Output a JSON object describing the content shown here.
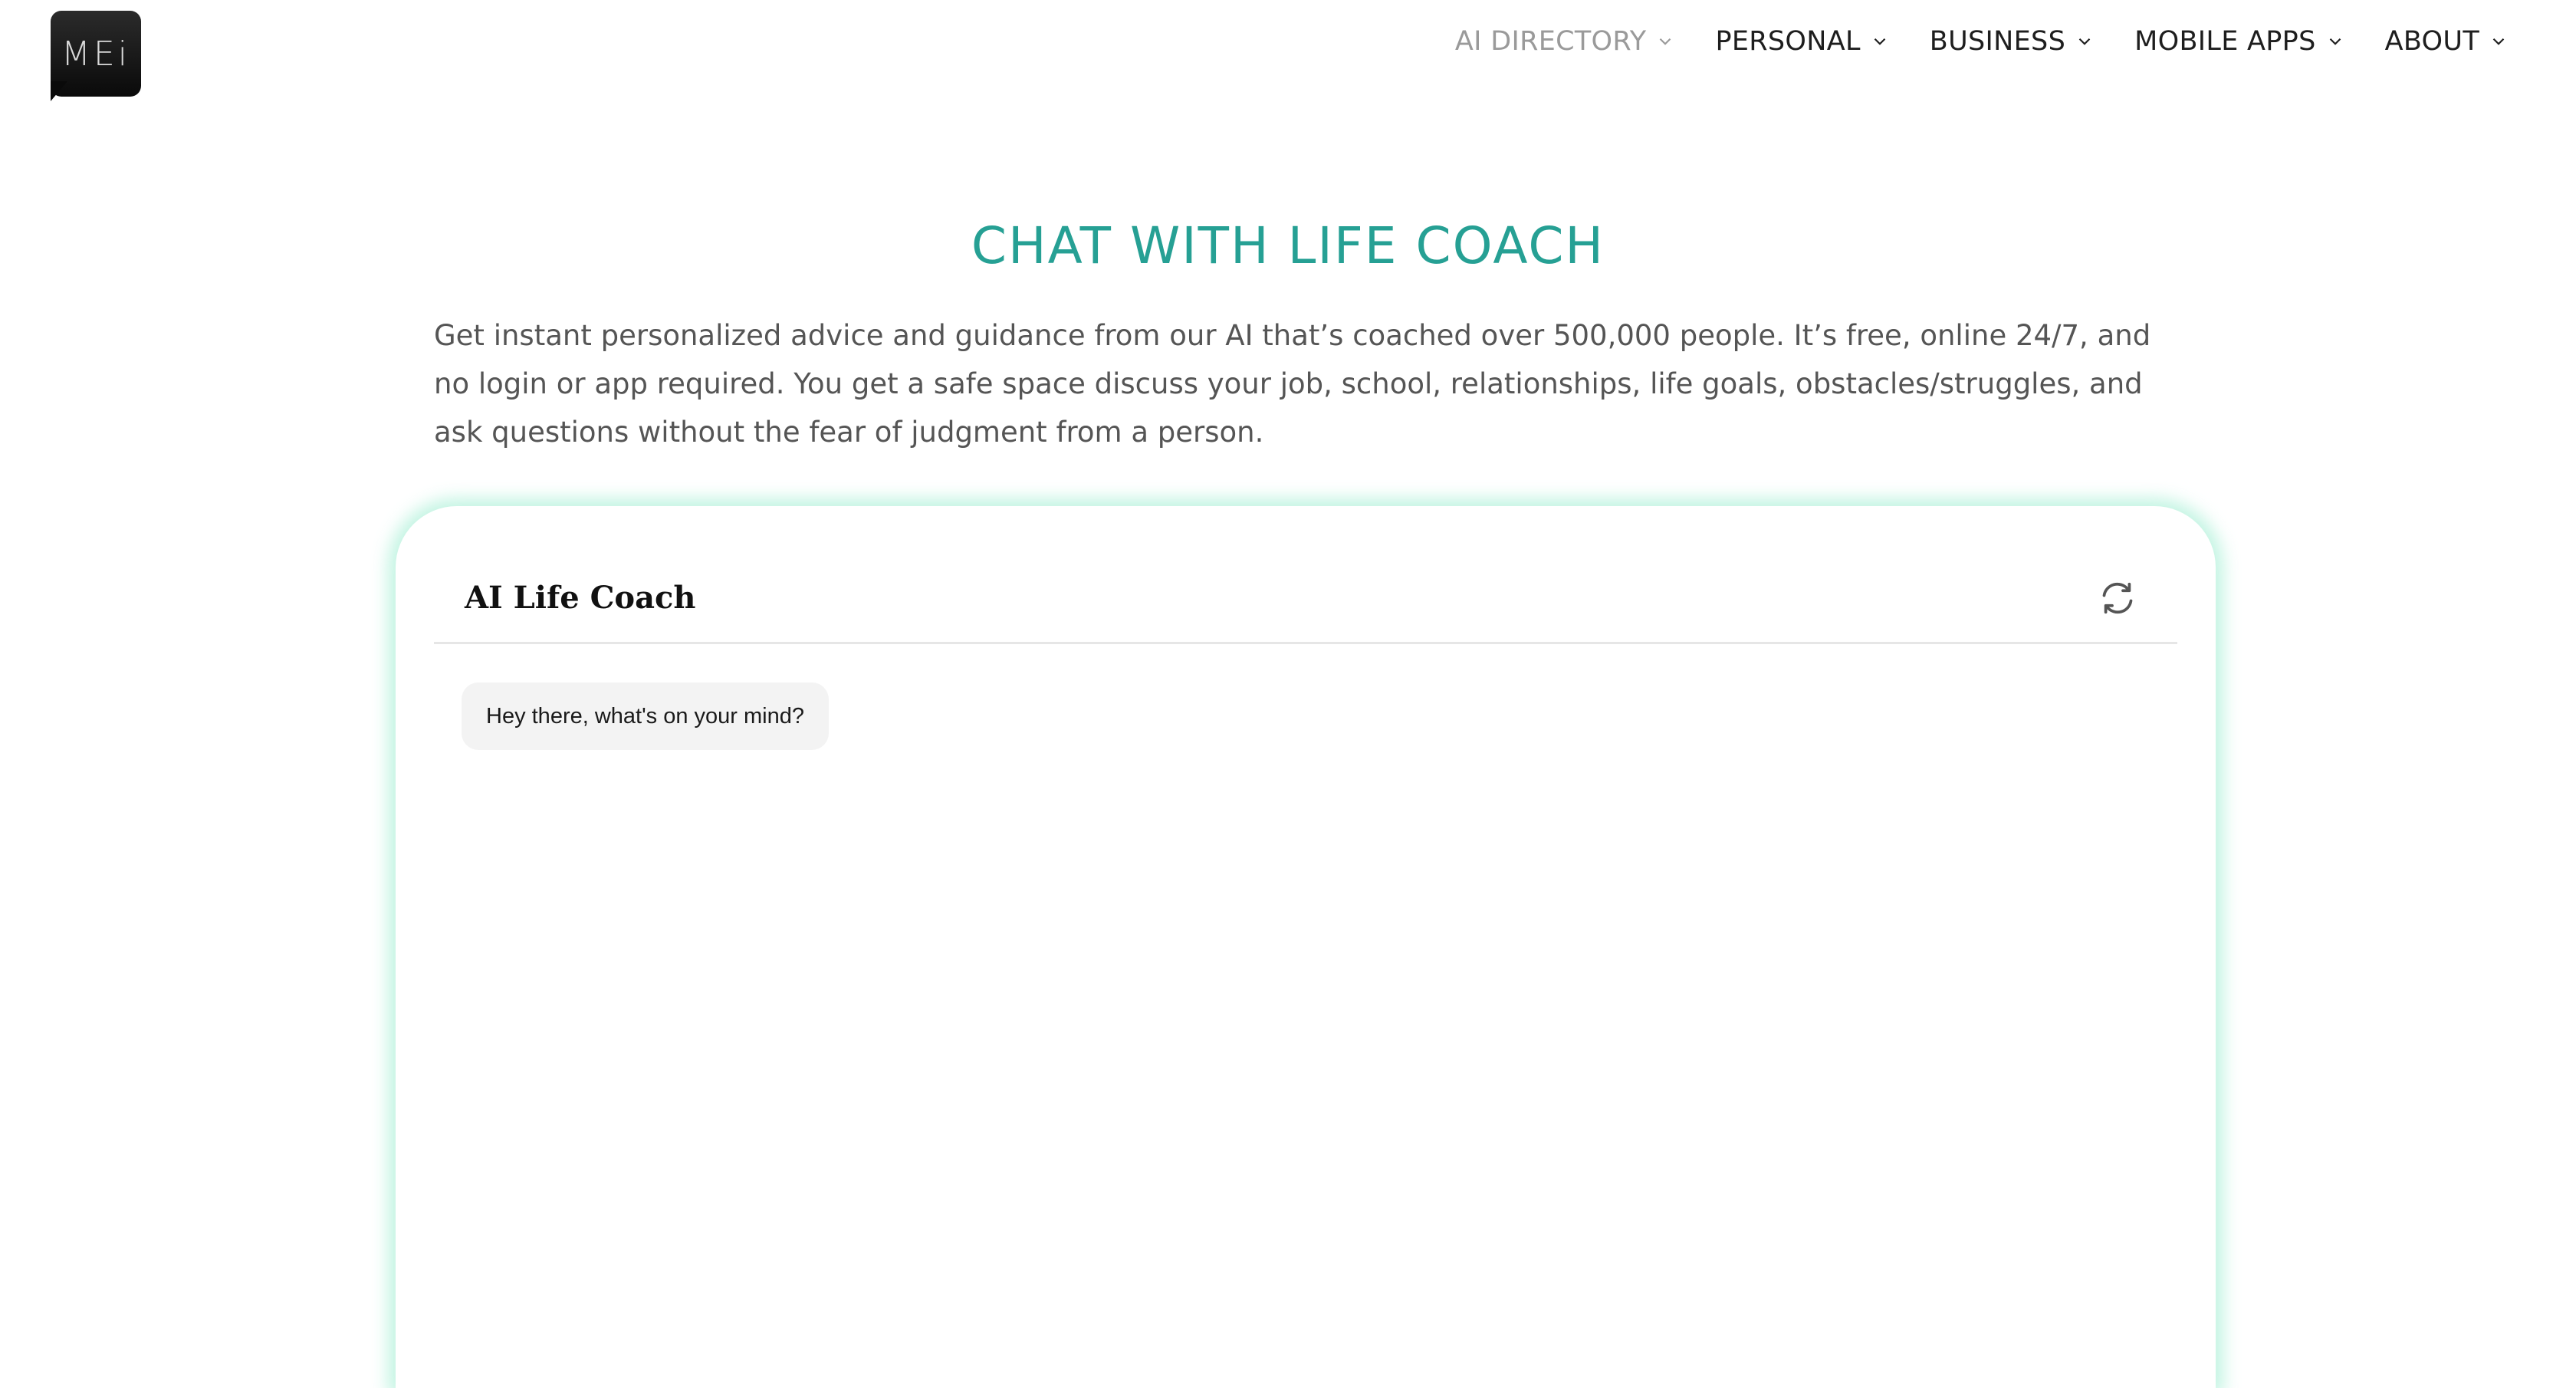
{
  "logo": {
    "text": "MEi"
  },
  "nav": {
    "items": [
      {
        "label": "AI DIRECTORY",
        "active": true
      },
      {
        "label": "PERSONAL",
        "active": false
      },
      {
        "label": "BUSINESS",
        "active": false
      },
      {
        "label": "MOBILE APPS",
        "active": false
      },
      {
        "label": "ABOUT",
        "active": false
      }
    ]
  },
  "hero": {
    "title": "CHAT WITH LIFE COACH",
    "description": "Get instant personalized advice and guidance from our AI that’s coached over 500,000 people.  It’s free, online 24/7, and no login or app required.  You get a safe space discuss your job, school, relationships, life goals, obstacles/struggles, and ask questions without the fear of judgment from a person."
  },
  "chat": {
    "title": "AI Life Coach",
    "messages": [
      {
        "from": "bot",
        "text": "Hey there, what's on your mind?"
      }
    ]
  },
  "colors": {
    "accent": "#26a094",
    "glow": "#78e6be",
    "nav_text": "#1e1e1e",
    "nav_active": "#9a9a9a",
    "body_text": "#555555"
  },
  "icons": {
    "refresh": "refresh-icon",
    "chevron": "chevron-down-icon"
  }
}
